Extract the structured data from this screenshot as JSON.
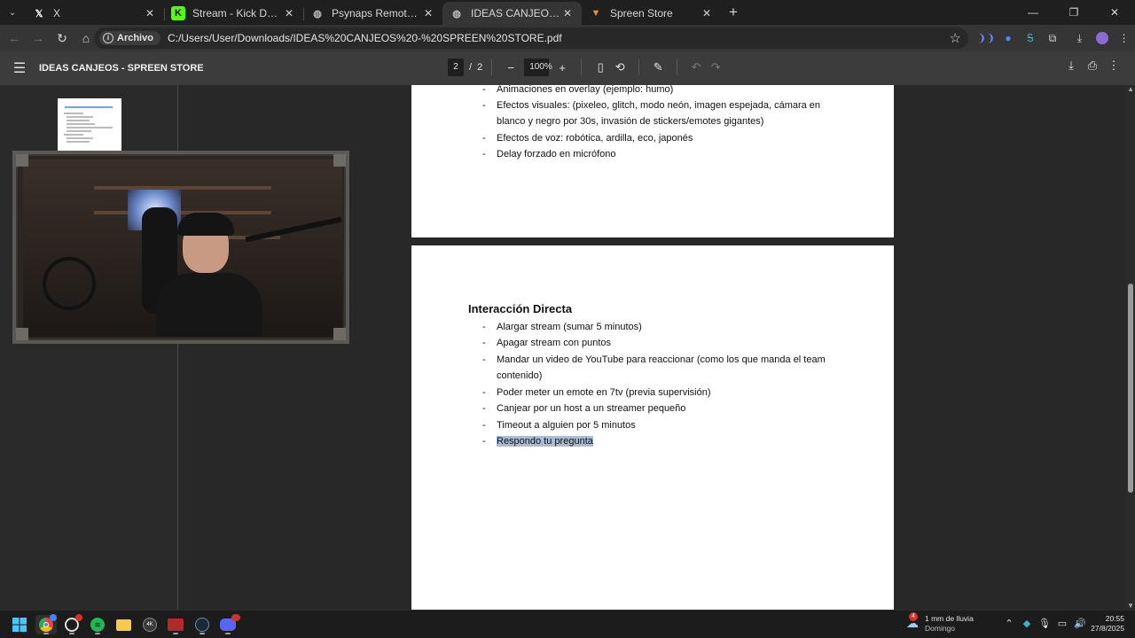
{
  "browser": {
    "tabs": [
      {
        "title": "X",
        "favicon": "x-logo-icon",
        "active": false
      },
      {
        "title": "Stream - Kick Dashboard",
        "favicon": "kick-logo-icon",
        "active": false
      },
      {
        "title": "Psynaps Remote Control",
        "favicon": "globe-icon",
        "active": false
      },
      {
        "title": "IDEAS CANJEOS - SPREEN STORE",
        "favicon": "globe-icon",
        "active": true
      },
      {
        "title": "Spreen Store",
        "favicon": "spreen-store-icon",
        "active": false
      }
    ],
    "omnibox": {
      "chip_label": "Archivo",
      "url": "C:/Users/User/Downloads/IDEAS%20CANJEOS%20-%20SPREEN%20STORE.pdf"
    }
  },
  "pdf": {
    "title": "IDEAS CANJEOS - SPREEN STORE",
    "current_page": "2",
    "page_separator": "/",
    "total_pages": "2",
    "zoom": "100%",
    "page1_items": [
      "Animaciones en overlay (ejemplo: humo)",
      "Efectos visuales: (pixeleo, glitch, modo neón, imagen espejada, cámara en",
      "blanco y negro por 30s, invasión de stickers/emotes gigantes)",
      "Efectos de voz: robótica, ardilla, eco, japonés",
      "Delay forzado en micrófono"
    ],
    "section_heading": "Interacción Directa",
    "page2_items": [
      "Alargar stream (sumar 5 minutos)",
      "Apagar stream con puntos",
      "Mandar un video de YouTube para reaccionar (como los que manda el team",
      "contenido)",
      "Poder meter un emote en 7tv (previa supervisión)",
      "Canjear por un host a un streamer pequeño",
      "Timeout a alguien por 5 minutos",
      "Respondo tu pregunta"
    ],
    "bullet": "-"
  },
  "taskbar": {
    "weather_text": "1 mm de lluvia",
    "weather_sub": "Domingo",
    "weather_badge": "4",
    "time": "20:55",
    "date": "27/8/2025"
  },
  "colors": {
    "highlight": "#a9bcd6",
    "kick_green": "#53fc18",
    "spotify_green": "#1db954"
  }
}
